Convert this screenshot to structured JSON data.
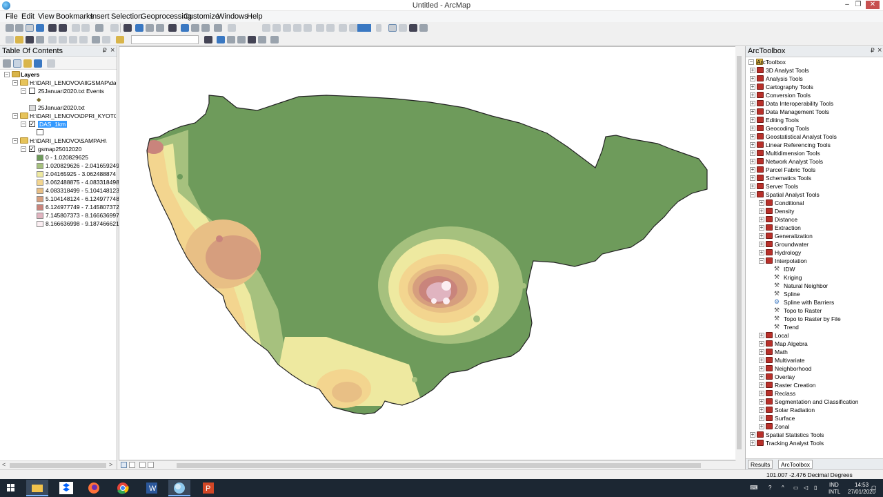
{
  "window": {
    "title": "Untitled - ArcMap",
    "min_label": "–",
    "max_label": "❐",
    "close_label": "✕"
  },
  "menu": [
    {
      "label": "File"
    },
    {
      "label": "Edit"
    },
    {
      "label": "View"
    },
    {
      "label": "Bookmarks"
    },
    {
      "label": "Insert"
    },
    {
      "label": "Selection"
    },
    {
      "label": "Geoprocessing"
    },
    {
      "label": "Customize"
    },
    {
      "label": "Windows"
    },
    {
      "label": "Help"
    }
  ],
  "toc": {
    "title": "Table Of Contents",
    "pin": "₽",
    "close": "×",
    "layers_label": "Layers",
    "groups": [
      {
        "path": "H:\\DARI_LENOVO\\AllGSMAP\\dataC"
      },
      {
        "path": "H:\\DARI_LENOVO\\DPRI_KYOTO\\da"
      },
      {
        "path": "H:\\DARI_LENOVO\\SAMPAH\\"
      }
    ],
    "events_layer": "25Januari2020.txt Events",
    "events_symbol": "◆",
    "table_item": "25Januari2020.txt",
    "das_layer": "DAS_1km",
    "raster_layer": "gsmap25012020",
    "legend": [
      {
        "label": "0 - 1.020829625",
        "color": "#6e9b5b"
      },
      {
        "label": "1.020829626 - 2.041659249",
        "color": "#a6c17e"
      },
      {
        "label": "2.04165925 - 3.062488874",
        "color": "#eee9a0"
      },
      {
        "label": "3.062488875 - 4.083318498",
        "color": "#f3d58f"
      },
      {
        "label": "4.083318499 - 5.104148123",
        "color": "#e8bf85"
      },
      {
        "label": "5.104148124 - 6.124977748",
        "color": "#d69e7e"
      },
      {
        "label": "6.124977749 - 7.145807372",
        "color": "#c9847c"
      },
      {
        "label": "7.145807373 - 8.166636997",
        "color": "#e0b4c0"
      },
      {
        "label": "8.166636998 - 9.187466621",
        "color": "#fbeef2"
      }
    ]
  },
  "toolbox": {
    "title": "ArcToolbox",
    "root": "ArcToolbox",
    "toolsets": [
      "3D Analyst Tools",
      "Analysis Tools",
      "Cartography Tools",
      "Conversion Tools",
      "Data Interoperability Tools",
      "Data Management Tools",
      "Editing Tools",
      "Geocoding Tools",
      "Geostatistical Analyst Tools",
      "Linear Referencing Tools",
      "Multidimension Tools",
      "Network Analyst Tools",
      "Parcel Fabric Tools",
      "Schematics Tools",
      "Server Tools",
      "Spatial Analyst Tools"
    ],
    "spatial_children_a": [
      "Conditional",
      "Density",
      "Distance",
      "Extraction",
      "Generalization",
      "Groundwater",
      "Hydrology",
      "Interpolation"
    ],
    "interpolation_tools": [
      "IDW",
      "Kriging",
      "Natural Neighbor",
      "Spline",
      "Spline with Barriers",
      "Topo to Raster",
      "Topo to Raster by File",
      "Trend"
    ],
    "spatial_children_b": [
      "Local",
      "Map Algebra",
      "Math",
      "Multivariate",
      "Neighborhood",
      "Overlay",
      "Raster Creation",
      "Reclass",
      "Segmentation and Classification",
      "Solar Radiation",
      "Surface",
      "Zonal"
    ],
    "toolsets_after": [
      "Spatial Statistics Tools",
      "Tracking Analyst Tools"
    ],
    "tabs": [
      "Results",
      "ArcToolbox"
    ]
  },
  "status": {
    "coordinates": "101.007  -2.476 Decimal Degrees"
  },
  "taskbar": {
    "apps": [
      "windows-start",
      "file-explorer",
      "dropbox",
      "firefox",
      "chrome",
      "word",
      "arcmap",
      "powerpoint"
    ],
    "lang": "IND",
    "layout": "INTL",
    "time": "14:53",
    "date": "27/01/2020"
  },
  "colors": {
    "class1": "#6e9b5b",
    "class2": "#a6c17e",
    "class3": "#eee9a0",
    "class4": "#f3d58f",
    "class5": "#e8bf85",
    "class6": "#d69e7e",
    "class7": "#c9847c",
    "class8": "#e0b4c0",
    "class9": "#fbeef2"
  }
}
